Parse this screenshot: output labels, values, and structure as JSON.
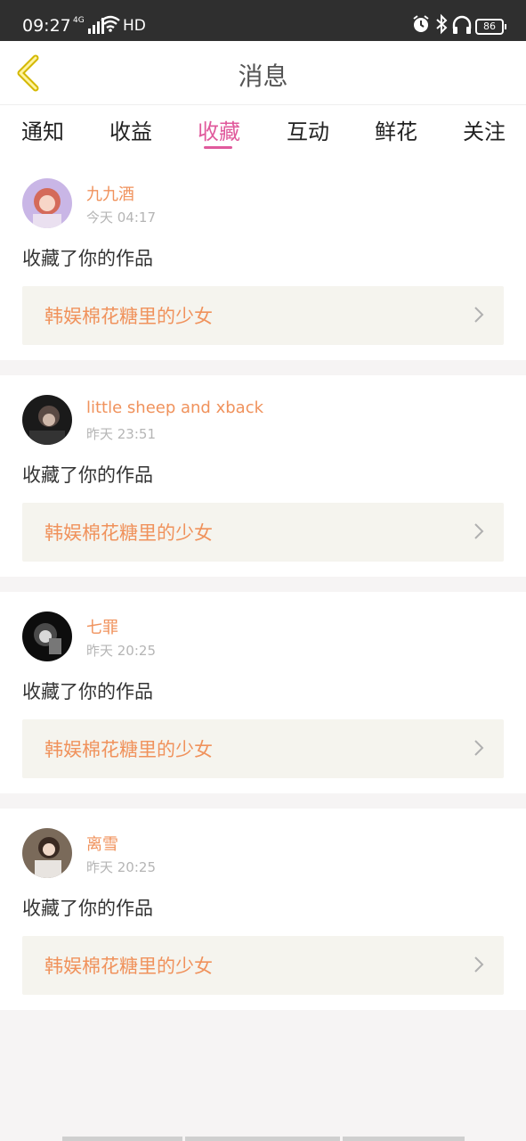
{
  "status_bar": {
    "time": "09:27",
    "network": "4G",
    "hd": "HD",
    "battery": "86",
    "icons": [
      "signal-icon",
      "wifi-icon",
      "alarm-icon",
      "bluetooth-icon",
      "headphones-icon",
      "battery-icon"
    ]
  },
  "header": {
    "title": "消息",
    "back_icon": "back-chevron-icon"
  },
  "tabs": [
    {
      "label": "通知",
      "active": false
    },
    {
      "label": "收益",
      "active": false
    },
    {
      "label": "收藏",
      "active": true
    },
    {
      "label": "互动",
      "active": false
    },
    {
      "label": "鲜花",
      "active": false
    },
    {
      "label": "关注",
      "active": false
    }
  ],
  "colors": {
    "accent": "#e05a9c",
    "name": "#f0925c",
    "time": "#b5b5b5",
    "work_bg": "#f5f4ee"
  },
  "messages": [
    {
      "user": "九九酒",
      "time": "今天 04:17",
      "action": "收藏了你的作品",
      "work": "韩娱棉花糖里的少女"
    },
    {
      "user": "little sheep and xback",
      "time": "昨天 23:51",
      "action": "收藏了你的作品",
      "work": "韩娱棉花糖里的少女"
    },
    {
      "user": "七罪",
      "time": "昨天 20:25",
      "action": "收藏了你的作品",
      "work": "韩娱棉花糖里的少女"
    },
    {
      "user": "离雪",
      "time": "昨天 20:25",
      "action": "收藏了你的作品",
      "work": "韩娱棉花糖里的少女"
    }
  ]
}
